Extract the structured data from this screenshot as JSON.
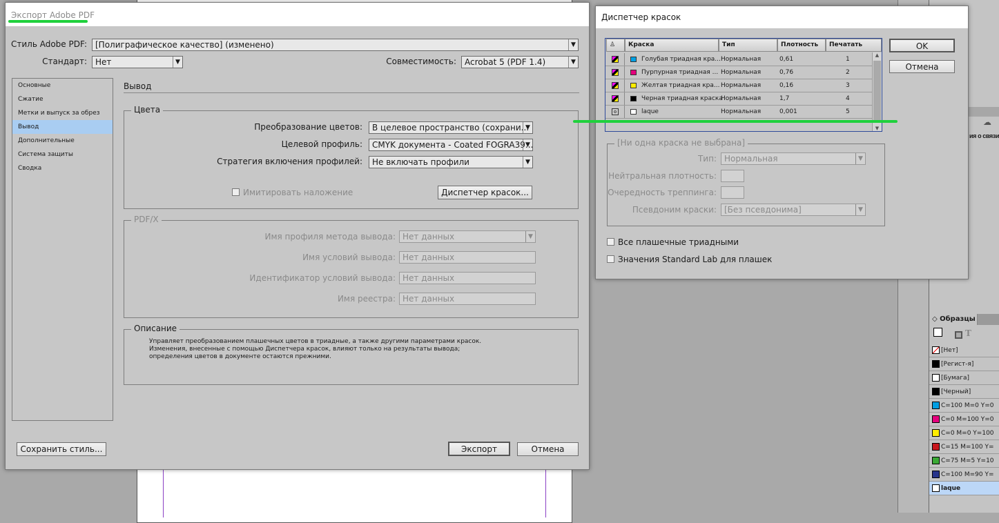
{
  "export_dialog": {
    "title": "Экспорт Adobe PDF",
    "preset_label": "Стиль Adobe PDF:",
    "preset_value": "[Полиграфическое качество] (изменено)",
    "standard_label": "Стандарт:",
    "standard_value": "Нет",
    "compat_label": "Совместимость:",
    "compat_value": "Acrobat 5 (PDF 1.4)",
    "nav": [
      "Основные",
      "Сжатие",
      "Метки и выпуск за обрез",
      "Вывод",
      "Дополнительные",
      "Система защиты",
      "Сводка"
    ],
    "nav_selected": 3,
    "section_title": "Вывод",
    "colors": {
      "title": "Цвета",
      "conv_label": "Преобразование цветов:",
      "conv_value": "В целевое пространство (сохрани...",
      "dest_label": "Целевой профиль:",
      "dest_value": "CMYK документа - Coated FOGRA39...",
      "incl_label": "Стратегия включения профилей:",
      "incl_value": "Не включать профили",
      "simulate": "Имитировать наложение",
      "ink_manager": "Диспетчер красок..."
    },
    "pdfx": {
      "title": "PDF/X",
      "profile_label": "Имя профиля метода вывода:",
      "profile_value": "Нет данных",
      "cond_label": "Имя условий вывода:",
      "cond_value": "Нет данных",
      "id_label": "Идентификатор условий вывода:",
      "id_value": "Нет данных",
      "reg_label": "Имя реестра:",
      "reg_value": "Нет данных"
    },
    "description": {
      "title": "Описание",
      "text1": "Управляет преобразованием плашечных цветов в триадные, а также другими параметрами красок.",
      "text2": "Изменения, внесенные с помощью Диспетчера красок, влияют только на результаты вывода;",
      "text3": "определения цветов в документе остаются прежними."
    },
    "save_preset": "Сохранить стиль...",
    "export": "Экспорт",
    "cancel": "Отмена"
  },
  "ink_dialog": {
    "title": "Диспетчер красок",
    "columns": [
      "Краска",
      "Тип",
      "Плотность",
      "Печатать"
    ],
    "inks": [
      {
        "name": "Голубая триадная кра...",
        "type": "Нормальная",
        "density": "0,61",
        "order": "1",
        "color": "#00a0e3",
        "kind": "process"
      },
      {
        "name": "Пурпурная триадная ...",
        "type": "Нормальная",
        "density": "0,76",
        "order": "2",
        "color": "#e4007d",
        "kind": "process"
      },
      {
        "name": "Желтая триадная кра...",
        "type": "Нормальная",
        "density": "0,16",
        "order": "3",
        "color": "#ffed00",
        "kind": "process"
      },
      {
        "name": "Черная триадная краска",
        "type": "Нормальная",
        "density": "1,7",
        "order": "4",
        "color": "#000000",
        "kind": "process"
      },
      {
        "name": "laque",
        "type": "Нормальная",
        "density": "0,001",
        "order": "5",
        "color": "#ffffff",
        "kind": "spot"
      }
    ],
    "ok": "OK",
    "cancel": "Отмена",
    "group_title": "[Ни одна краска не выбрана]",
    "type_label": "Тип:",
    "type_value": "Нормальная",
    "nd_label": "Нейтральная плотность:",
    "trap_label": "Очередность треппинга:",
    "alias_label": "Псевдоним краски:",
    "alias_value": "[Без псевдонима]",
    "all_spots": "Все плашечные триадными",
    "std_lab": "Значения Standard Lab для плашек"
  },
  "swatches_panel": {
    "title": "Образцы",
    "links_text": "ия о связи",
    "items": [
      {
        "name": "[Нет]",
        "color": "none"
      },
      {
        "name": "[Регист-я]",
        "color": "#000000"
      },
      {
        "name": "[Бумага]",
        "color": "#ffffff"
      },
      {
        "name": "[Черный]",
        "color": "#000000"
      },
      {
        "name": "C=100 M=0 Y=0",
        "color": "#009fe3"
      },
      {
        "name": "C=0 M=100 Y=0",
        "color": "#e5007e"
      },
      {
        "name": "C=0 M=0 Y=100",
        "color": "#ffed00"
      },
      {
        "name": "C=15 M=100 Y=",
        "color": "#c8161d"
      },
      {
        "name": "C=75 M=5 Y=10",
        "color": "#3aa935"
      },
      {
        "name": "C=100 M=90 Y=",
        "color": "#27348b"
      },
      {
        "name": "laque",
        "color": "#ffffff"
      }
    ],
    "selected": 10
  }
}
